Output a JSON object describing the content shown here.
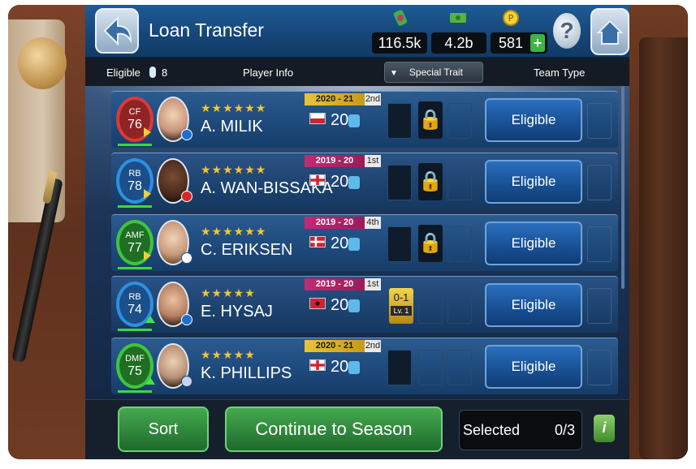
{
  "header": {
    "title": "Loan Transfer",
    "currency": [
      {
        "icon": "gp-icon",
        "value": "116.5k"
      },
      {
        "icon": "cash-icon",
        "value": "4.2b"
      },
      {
        "icon": "coin-icon",
        "value": "581"
      }
    ],
    "help_label": "?"
  },
  "columns": {
    "eligible_label": "Eligible",
    "eligible_count": "8",
    "player_info": "Player Info",
    "special_trait": "Special Trait",
    "team_type": "Team Type"
  },
  "players": [
    {
      "position": "CF",
      "rating": "76",
      "stars": "★★★★★★",
      "name": "A. MILIK",
      "season": "2020 - 21",
      "slot": "2nd",
      "season_color": "gold",
      "age": "20",
      "status": "Eligible",
      "pos_color": "#d93a3a"
    },
    {
      "position": "RB",
      "rating": "78",
      "stars": "★★★★★★",
      "name": "A. WAN-BISSAKA",
      "season": "2019 - 20",
      "slot": "1st",
      "season_color": "pink",
      "age": "20",
      "status": "Eligible",
      "pos_color": "#2f8fe0"
    },
    {
      "position": "AMF",
      "rating": "77",
      "stars": "★★★★★★",
      "name": "C. ERIKSEN",
      "season": "2019 - 20",
      "slot": "4th",
      "season_color": "pink",
      "age": "20",
      "status": "Eligible",
      "pos_color": "#3ec53e"
    },
    {
      "position": "RB",
      "rating": "74",
      "stars": "★★★★★",
      "name": "E. HYSAJ",
      "season": "2019 - 20",
      "slot": "1st",
      "season_color": "pink",
      "age": "20",
      "status": "Eligible",
      "pos_color": "#2f8fe0",
      "trait_top": "0-1",
      "trait_level": "Lv. 1"
    },
    {
      "position": "DMF",
      "rating": "75",
      "stars": "★★★★★",
      "name": "K. PHILLIPS",
      "season": "2020 - 21",
      "slot": "2nd",
      "season_color": "gold",
      "age": "20",
      "status": "Eligible",
      "pos_color": "#3ec53e"
    }
  ],
  "footer": {
    "sort_label": "Sort",
    "continue_label": "Continue to Season",
    "selected_label": "Selected",
    "selected_count": "0/3",
    "info_label": "i"
  }
}
